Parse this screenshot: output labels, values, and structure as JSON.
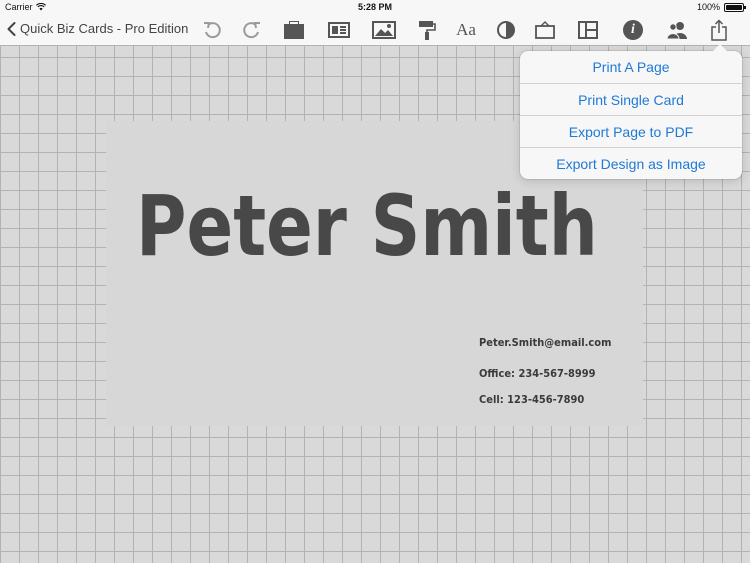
{
  "status_bar": {
    "carrier": "Carrier",
    "time": "5:28 PM",
    "battery": "100%",
    "battery_level": 1.0
  },
  "nav": {
    "back_label": "Quick Biz Cards - Pro Edition",
    "tools": [
      {
        "name": "undo-icon"
      },
      {
        "name": "redo-icon"
      },
      {
        "name": "card-template-icon"
      },
      {
        "name": "card-layout-icon"
      },
      {
        "name": "image-icon"
      },
      {
        "name": "paint-roller-icon"
      },
      {
        "name": "font-icon",
        "label": "Aa"
      },
      {
        "name": "contrast-icon"
      },
      {
        "name": "shape-icon"
      },
      {
        "name": "panels-icon"
      },
      {
        "name": "info-icon",
        "label": "i"
      },
      {
        "name": "contacts-icon"
      },
      {
        "name": "share-icon"
      }
    ]
  },
  "card": {
    "name": "Peter Smith",
    "email": "Peter.Smith@email.com",
    "office": "Office: 234-567-8999",
    "cell": "Cell: 123-456-7890"
  },
  "share_menu": {
    "items": [
      {
        "label": "Print A Page"
      },
      {
        "label": "Print Single Card"
      },
      {
        "label": "Export Page to PDF"
      },
      {
        "label": "Export Design as Image"
      }
    ]
  },
  "colors": {
    "accent": "#1f7ad6",
    "icon": "#555555",
    "disabled_icon": "#9a9a9a",
    "card_text": "#484848"
  }
}
